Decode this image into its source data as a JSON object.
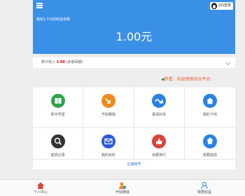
{
  "header": {
    "qq_button": "QQ登录"
  },
  "balance": {
    "label": "我有1.5元的收益余额",
    "amount": "1.00元"
  },
  "income": {
    "prefix": "累计收入",
    "value": "1.00",
    "suffix": "(含看码额)"
  },
  "notice": {
    "text": "恭喜：欢迎使用创业平台"
  },
  "grid": [
    {
      "label": "新手学堂",
      "icon": "book-icon",
      "color": "#2ea44f"
    },
    {
      "label": "开始赚钱",
      "icon": "arrow-icon",
      "color": "#f08a1c"
    },
    {
      "label": "邀请好友",
      "icon": "invite-icon",
      "color": "#2a82e4"
    },
    {
      "label": "我的下线",
      "icon": "house-icon",
      "color": "#2a82e4"
    },
    {
      "label": "提现记录",
      "icon": "search-icon",
      "color": "#333333"
    },
    {
      "label": "我的资料",
      "icon": "mail-icon",
      "color": "#2a5bd7"
    },
    {
      "label": "余额排行",
      "icon": "thumbs-up-icon",
      "color": "#d9453b"
    },
    {
      "label": "我要提现",
      "icon": "withdraw-icon",
      "color": "#2a82e4"
    }
  ],
  "logout": "注销账号",
  "tabs": [
    {
      "label": "个人中心",
      "icon": "home-icon",
      "color": "#d9453b"
    },
    {
      "label": "开始赚钱",
      "icon": "earn-icon",
      "color": "#f08a1c"
    },
    {
      "label": "我要收益",
      "icon": "user-icon",
      "color": "#2a82e4"
    }
  ]
}
